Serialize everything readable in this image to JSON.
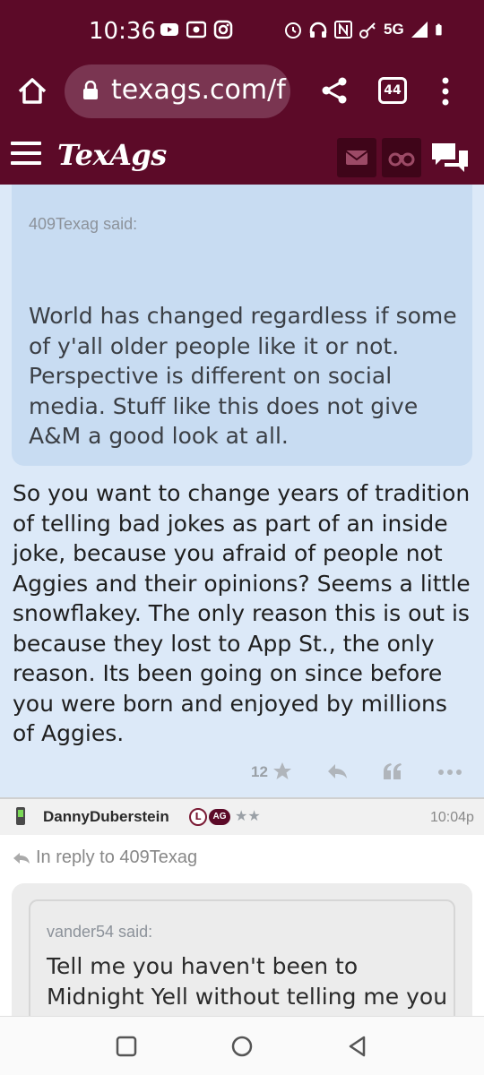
{
  "status_bar": {
    "time": "10:36",
    "network": "5G",
    "left_icons": [
      "youtube-icon",
      "radio-icon",
      "instagram-icon"
    ],
    "right_icons": [
      "alarm-icon",
      "headphones-icon",
      "nfc-icon",
      "key-icon",
      "signal-icon",
      "battery-icon"
    ]
  },
  "browser": {
    "url": "texags.com/f",
    "tab_count": "44"
  },
  "site": {
    "logo": "TexAgs",
    "brand_color": "#5c0a28"
  },
  "post1": {
    "quote_author": "409Texag said:",
    "quote_text": "World has changed regardless if some of y'all older people like it or not. Perspective is different on social media. Stuff like this does not give A&M a good look at all.",
    "body": "So you want to change years of tradition of telling bad jokes as part of an inside joke, because you afraid of people not Aggies and their opinions? Seems a little snowflakey. The only reason this is out is because they lost to App St., the only reason. Its been going on since before you were born and enjoyed by millions of Aggies.",
    "likes": "12"
  },
  "post2": {
    "username": "DannyDuberstein",
    "badge_l": "L",
    "badge_ag": "AG",
    "stars": "★★",
    "time": "10:04p",
    "reply_to": "In reply to 409Texag",
    "quote_author": "vander54 said:",
    "quote_text": "Tell me you haven't been to Midnight Yell without telling me you haven't been to Midnight Yell"
  }
}
